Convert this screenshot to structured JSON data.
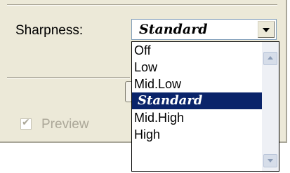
{
  "dialog": {
    "sharpness_label": "Sharpness:",
    "sharpness_value": "Standard",
    "preview_label": "Preview",
    "preview_checked": true,
    "preview_enabled": false
  },
  "dropdown": {
    "options": [
      {
        "label": "Off"
      },
      {
        "label": "Low"
      },
      {
        "label": "Mid.Low"
      },
      {
        "label": "Standard"
      },
      {
        "label": "Mid.High"
      },
      {
        "label": "High"
      }
    ],
    "selected": "Standard",
    "highlight_color": "#0a246a"
  },
  "icons": {
    "combo_arrow": "chevron-down-icon",
    "scroll_up": "scroll-up-arrow-icon",
    "scroll_down": "scroll-down-arrow-icon",
    "check": "checkmark-icon"
  }
}
